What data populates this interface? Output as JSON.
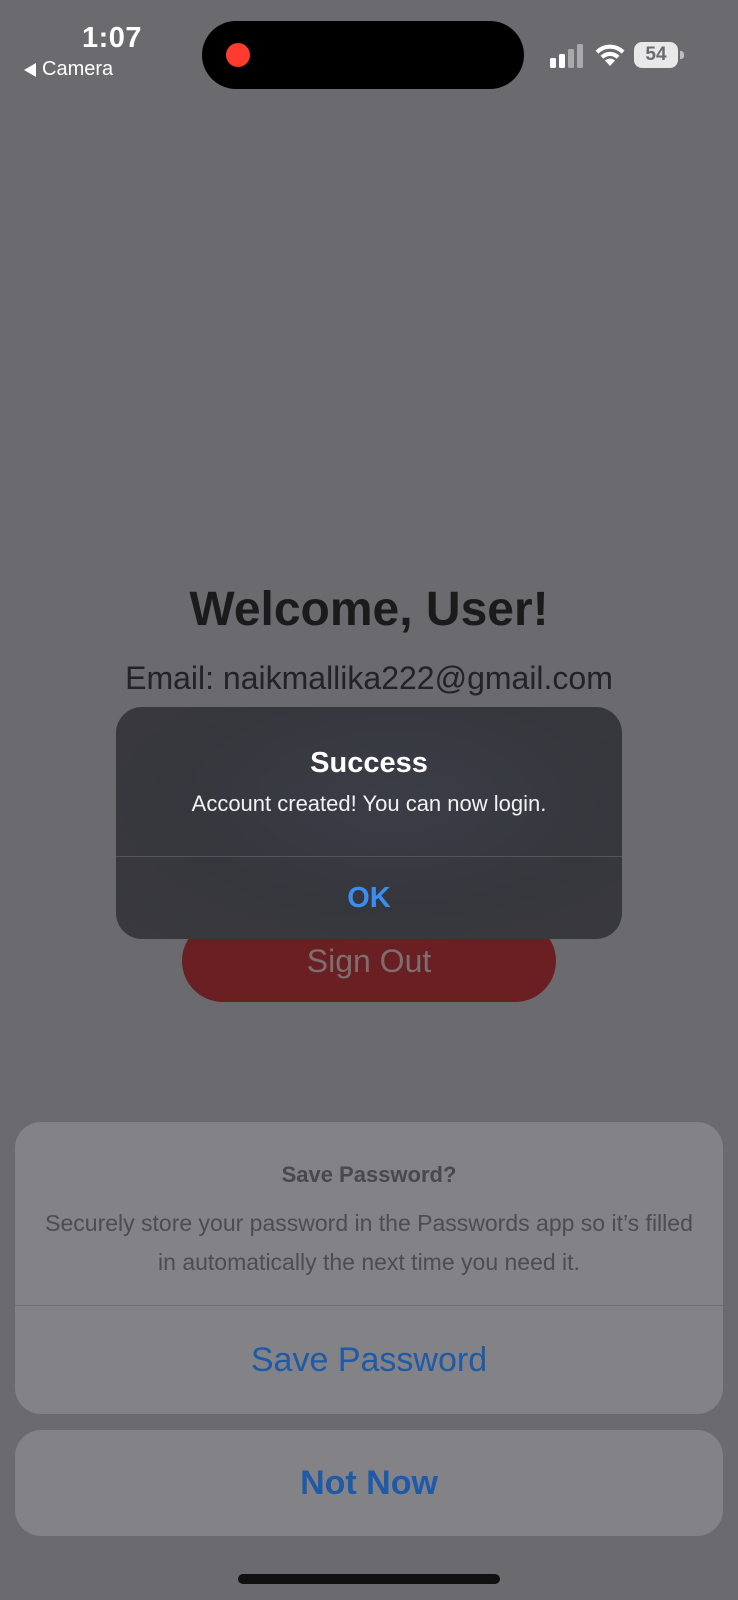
{
  "status_bar": {
    "time": "1:07",
    "back_app": "Camera",
    "battery_level": "54",
    "signal_bars_filled": 2,
    "signal_bars_total": 4
  },
  "page": {
    "welcome": "Welcome, User!",
    "email": "Email: naikmallika222@gmail.com",
    "sign_out": "Sign Out"
  },
  "alert": {
    "title": "Success",
    "message": "Account created! You can now login.",
    "ok": "OK"
  },
  "password_sheet": {
    "title": "Save Password?",
    "body": "Securely store your password in the Passwords app so it’s filled in automatically the next time you need it.",
    "save": "Save Password",
    "not_now": "Not Now"
  },
  "colors": {
    "overlay_bg": "#6b6a6e",
    "sign_out_bg": "#6a2022",
    "alert_ok": "#3c8df0",
    "sheet_action": "#1f5aa8",
    "recording_dot": "#ff3b30"
  },
  "icons": {
    "back": "back-triangle-icon",
    "recording": "recording-dot-icon",
    "signal": "cellular-signal-icon",
    "wifi": "wifi-icon",
    "battery": "battery-icon"
  }
}
